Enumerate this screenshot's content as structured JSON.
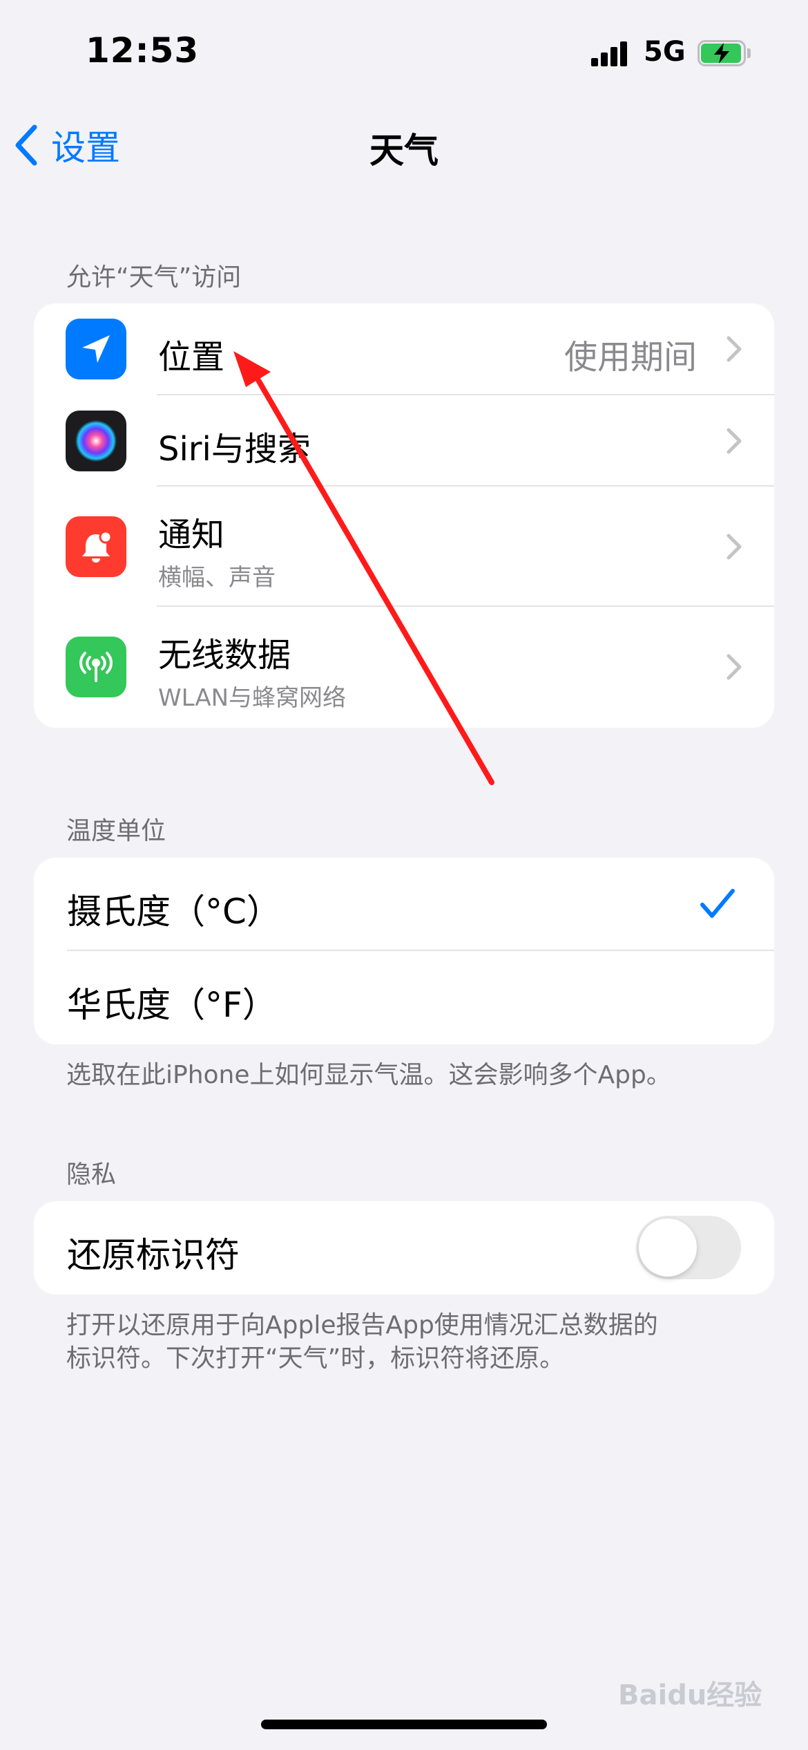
{
  "status_bar": {
    "time": "12:53",
    "network": "5G",
    "signal_icon": "signal-bars-icon",
    "battery_icon": "battery-charging-icon",
    "battery_color": "#34c759"
  },
  "nav": {
    "back_label": "设置",
    "back_icon": "chevron-left-icon",
    "title": "天气",
    "accent": "#007aff"
  },
  "access_section": {
    "header": "允许“天气”访问",
    "items": [
      {
        "title": "位置",
        "value": "使用期间",
        "icon": "location-arrow-icon",
        "icon_color": "#007aff"
      },
      {
        "title": "Siri与搜索",
        "icon": "siri-icon",
        "icon_color": "#1c1c1e"
      },
      {
        "title": "通知",
        "subtitle": "横幅、声音",
        "icon": "notification-bell-icon",
        "icon_color": "#ff3b30"
      },
      {
        "title": "无线数据",
        "subtitle": "WLAN与蜂窝网络",
        "icon": "antenna-icon",
        "icon_color": "#34c759"
      }
    ]
  },
  "temperature_section": {
    "header": "温度单位",
    "options": [
      {
        "label": "摄氏度（°C）",
        "selected": true
      },
      {
        "label": "华氏度（°F）",
        "selected": false
      }
    ],
    "footer": "选取在此iPhone上如何显示气温。这会影响多个App。"
  },
  "privacy_section": {
    "header": "隐私",
    "toggle_label": "还原标识符",
    "toggle_on": false,
    "footer_line1": "打开以还原用于向Apple报告App使用情况汇总数据的",
    "footer_line2": "标识符。下次打开“天气”时，标识符将还原。"
  },
  "annotation": {
    "color": "#ff1a1a"
  },
  "watermark": "Baidu经验"
}
